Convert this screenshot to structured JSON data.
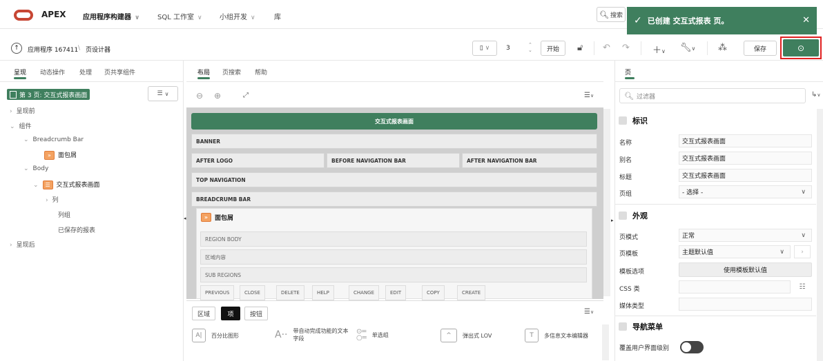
{
  "topbar": {
    "brand": "APEX",
    "menus": [
      {
        "label": "应用程序构建器",
        "bold": true
      },
      {
        "label": "SQL 工作室",
        "bold": false
      },
      {
        "label": "小组开发",
        "bold": false
      },
      {
        "label": "库",
        "bold": false
      }
    ],
    "search_label": "搜索",
    "toast": "已创建 交互式报表 页。"
  },
  "toolbar": {
    "breadcrumb_app": "应用程序 167411",
    "breadcrumb_sep": "\\",
    "breadcrumb_page": "页设计器",
    "page_number": "3",
    "go_label": "开始",
    "save_label": "保存"
  },
  "left": {
    "tabs": [
      "呈现",
      "动态操作",
      "处理",
      "页共享组件"
    ],
    "page_node": "第 3 页: 交互式报表画面",
    "tree": {
      "pre": "呈现前",
      "components": "组件",
      "breadcrumb_bar": "Breadcrumb Bar",
      "breadcrumb_region": "面包屑",
      "body": "Body",
      "ir_region": "交互式报表画面",
      "columns": "列",
      "column_groups": "列组",
      "saved_reports": "已保存的报表",
      "post": "呈现后"
    }
  },
  "middle": {
    "tabs": [
      "布局",
      "页搜索",
      "帮助"
    ],
    "title_region": "交互式报表画面",
    "banner": "BANNER",
    "after_logo": "AFTER LOGO",
    "before_nav": "BEFORE NAVIGATION BAR",
    "after_nav": "AFTER NAVIGATION BAR",
    "top_nav": "TOP NAVIGATION",
    "breadcrumb_bar": "BREADCRUMB BAR",
    "breadcrumb_card": "面包屑",
    "region_body": "REGION BODY",
    "region_content": "区域内容",
    "sub_regions": "SUB REGIONS",
    "buttons": [
      "PREVIOUS",
      "CLOSE",
      "DELETE",
      "HELP",
      "CHANGE",
      "EDIT",
      "COPY",
      "CREATE"
    ],
    "bottom_tabs": [
      "区域",
      "项",
      "按钮"
    ],
    "items_row1": [
      "百分比图形",
      "带自动完成功能的文本字段",
      "单选组",
      "弹出式 LOV",
      "多信息文本编辑器"
    ]
  },
  "right": {
    "tab": "页",
    "filter_placeholder": "过滤器",
    "sec_ident": "标识",
    "name_label": "名称",
    "name_value": "交互式报表画面",
    "alias_label": "别名",
    "alias_value": "交互式报表画面",
    "title_label": "标题",
    "title_value": "交互式报表画面",
    "group_label": "页组",
    "group_value": "- 选择 -",
    "sec_appearance": "外观",
    "mode_label": "页模式",
    "mode_value": "正常",
    "template_label": "页模板",
    "template_value": "主题默认值",
    "tmpl_opts_label": "模板选项",
    "tmpl_opts_button": "使用模板默认值",
    "css_label": "CSS 类",
    "media_label": "媒体类型",
    "sec_nav": "导航菜单",
    "override_label": "覆盖用户界面级别"
  },
  "colors": {
    "accent": "#3f7f5e",
    "highlight": "#e02020",
    "oracle_red": "#c74634"
  }
}
